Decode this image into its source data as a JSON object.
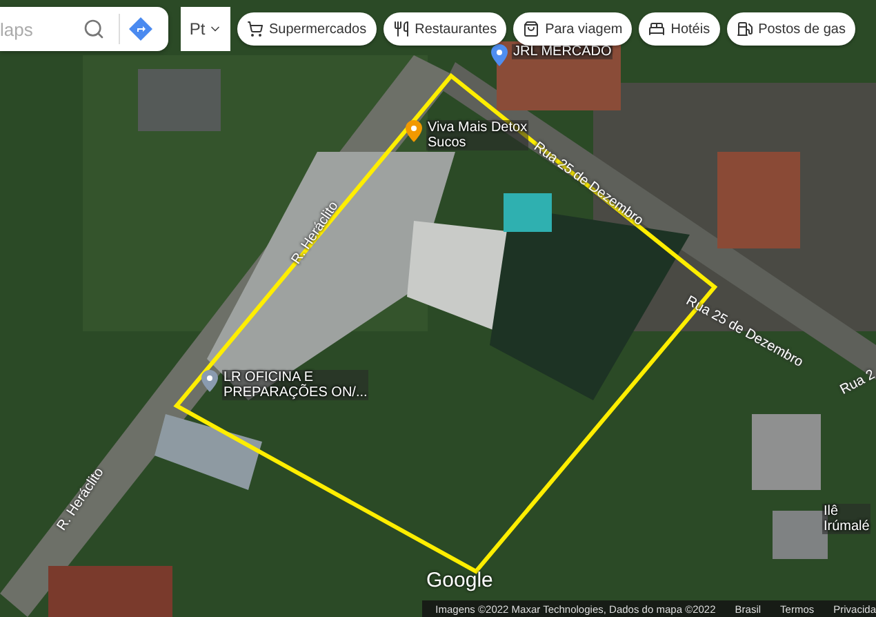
{
  "search": {
    "placeholder": "laps"
  },
  "layers": {
    "label": "Pt"
  },
  "chips": [
    {
      "label": "Supermercados"
    },
    {
      "label": "Restaurantes"
    },
    {
      "label": "Para viagem"
    },
    {
      "label": "Hotéis"
    },
    {
      "label": "Postos de gas"
    }
  ],
  "places": [
    {
      "kind": "shop",
      "lines": [
        "JRL MERCADO"
      ]
    },
    {
      "kind": "food",
      "lines": [
        "Viva Mais Detox",
        "Sucos"
      ]
    },
    {
      "kind": "generic",
      "lines": [
        "LR OFICINA E",
        "PREPARAÇÕES ON/..."
      ]
    },
    {
      "kind": "none",
      "lines": [
        "Ilê",
        "Irúmalé"
      ]
    }
  ],
  "roads": [
    "R. Heráclito",
    "Rua 25 de Dezembro",
    "Rua 25 de Dezembro",
    "Rua 2",
    "R. Heráclito"
  ],
  "logo": "Google",
  "footer": {
    "attribution": "Imagens ©2022 Maxar Technologies, Dados do mapa ©2022",
    "links": [
      "Brasil",
      "Termos",
      "Privacida"
    ]
  }
}
